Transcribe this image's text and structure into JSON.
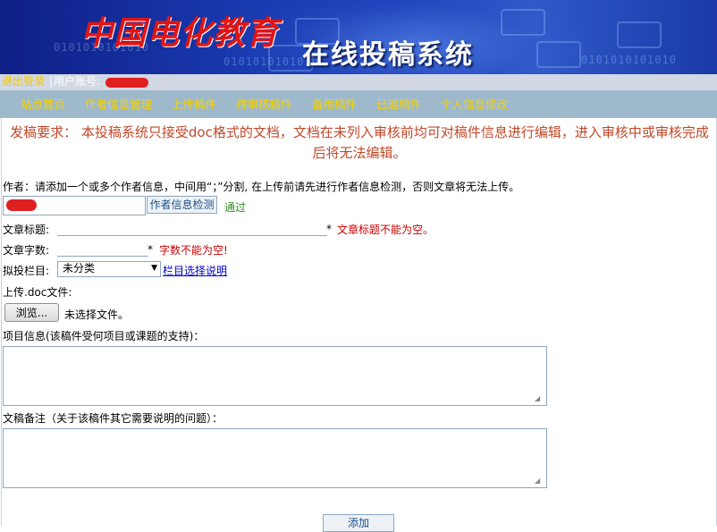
{
  "banner": {
    "logo_text": "中国电化教育",
    "system_title": "在线投稿系统",
    "binary_deco": "0101010101010"
  },
  "loginbar": {
    "logout": "退出登录",
    "separator": "|",
    "account_label": "用户账号:"
  },
  "nav": {
    "items": [
      {
        "label": "站点首页"
      },
      {
        "label": "作者信息管理"
      },
      {
        "label": "上传稿件"
      },
      {
        "label": "待审核稿件"
      },
      {
        "label": "备用稿件"
      },
      {
        "label": "已退稿件"
      },
      {
        "label": "个人信息修改"
      }
    ]
  },
  "notice": "发稿要求： 本投稿系统只接受doc格式的文档，文档在未列入审核前均可对稿件信息进行编辑，进入审核中或审核完成后将无法编辑。",
  "form": {
    "author_hint": "作者：请添加一个或多个作者信息，中间用“；”分割, 在上传前请先进行作者信息检测，否则文章将无法上传。",
    "author_check_button": "作者信息检测",
    "author_check_status": "通过",
    "title_label": "文章标题:",
    "title_required": "*",
    "title_error": "文章标题不能为空。",
    "wordcount_label": "文章字数:",
    "wordcount_required": "*",
    "wordcount_error": "字数不能为空!",
    "column_label": "拟投栏目:",
    "column_selected": "未分类",
    "column_help_link": "栏目选择说明",
    "upload_label": "上传.doc文件:",
    "browse_button": "浏览...",
    "no_file_text": "未选择文件。",
    "project_label": "项目信息(该稿件受何项目或课题的支持)：",
    "remark_label": "文稿备注（关于该稿件其它需要说明的问题）：",
    "submit_button": "添加"
  },
  "colors": {
    "banner_blue": "#1a3ab0",
    "logo_red": "#e21414",
    "nav_bg": "#9fb9cc",
    "nav_text": "#f5d300",
    "notice_text": "#c0482a",
    "error_red": "#cc0000",
    "pass_green": "#2e8b1e",
    "link_blue": "#0000cc"
  },
  "icons": {
    "select_arrow": "chevron-down-icon",
    "resize_grip": "resize-grip-icon"
  }
}
